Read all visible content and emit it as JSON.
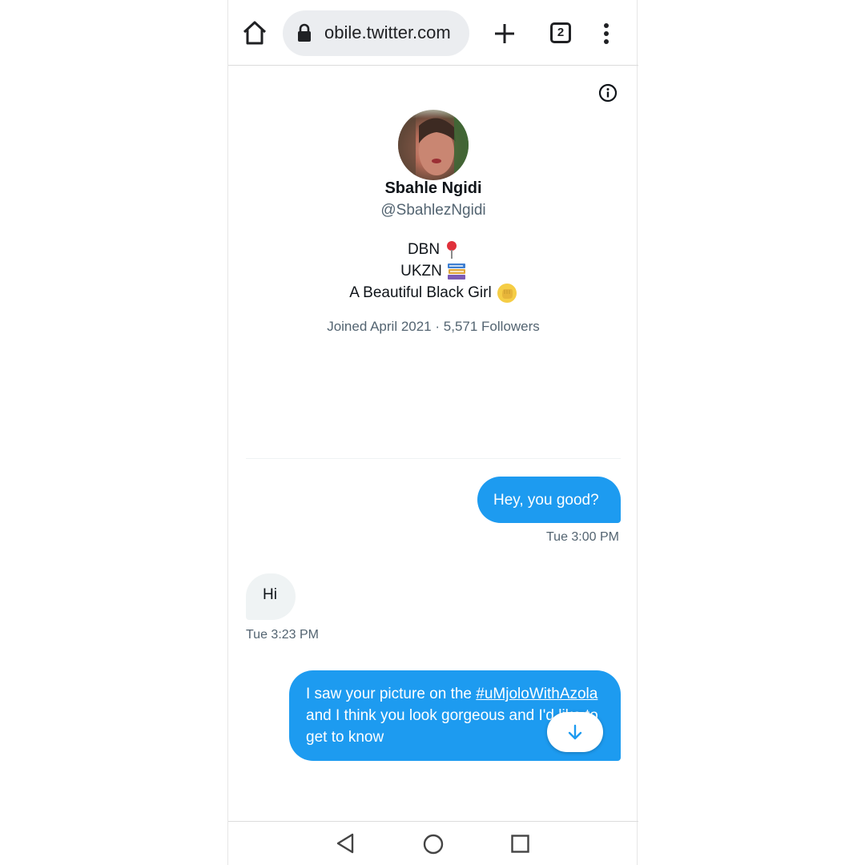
{
  "browser": {
    "url": "obile.twitter.com",
    "tab_count": "2",
    "icons": [
      "home-icon",
      "lock-icon",
      "plus-icon",
      "tabs-icon",
      "menu-dots-icon"
    ]
  },
  "profile": {
    "name": "Sbahle Ngidi",
    "handle": "@SbahlezNgidi",
    "bio": [
      "DBN",
      "UKZN",
      "A Beautiful Black Girl"
    ],
    "bio_emojis": [
      "pushpin-icon",
      "books-icon",
      "raised-fist-icon"
    ],
    "joined": "Joined April 2021",
    "separator": "·",
    "followers": "5,571 Followers"
  },
  "messages": [
    {
      "direction": "outgoing",
      "text": "Hey, you good?",
      "time": "Tue 3:00 PM"
    },
    {
      "direction": "incoming",
      "text": "Hi",
      "time": "Tue 3:23 PM"
    },
    {
      "direction": "outgoing",
      "text_before": "I saw your picture on the",
      "hashtag": "#uMjoloWithAzola",
      "text_after": "and I think you look gorgeous and I'd like to get to know"
    }
  ],
  "colors": {
    "accent": "#1d9bf0",
    "incoming_bubble": "#eff3f4",
    "secondary_text": "#536471"
  }
}
